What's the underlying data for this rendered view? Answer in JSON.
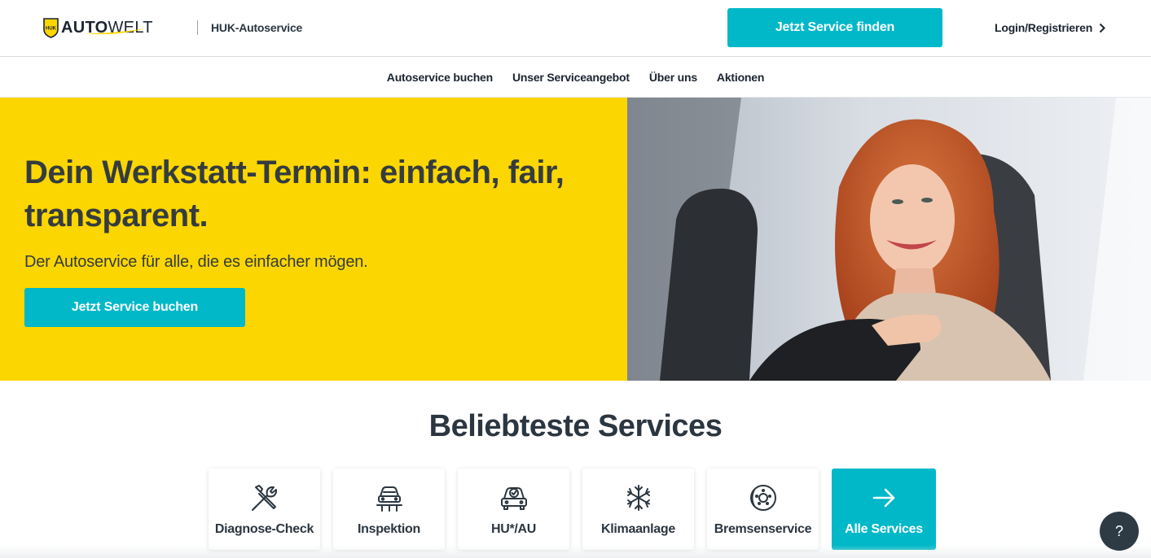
{
  "header": {
    "logo_text_bold": "AUTO",
    "logo_text_light": "WELT",
    "logo_badge_text": "HUK",
    "brand_sub": "HUK-Autoservice",
    "find_button": "Jetzt Service finden",
    "login_label": "Login/Registrieren"
  },
  "nav": {
    "items": [
      {
        "label": "Autoservice buchen"
      },
      {
        "label": "Unser Serviceangebot"
      },
      {
        "label": "Über uns"
      },
      {
        "label": "Aktionen"
      }
    ]
  },
  "hero": {
    "title": "Dein Werkstatt-Termin: einfach, fair, transparent.",
    "subtitle": "Der Autoservice für alle, die es einfacher mögen.",
    "book_button": "Jetzt Service buchen"
  },
  "services": {
    "title": "Beliebteste Services",
    "cards": [
      {
        "label": "Diagnose-Check",
        "icon": "wrench-screwdriver-icon"
      },
      {
        "label": "Inspektion",
        "icon": "car-lift-icon"
      },
      {
        "label": "HU*/AU",
        "icon": "car-check-icon"
      },
      {
        "label": "Klimaanlage",
        "icon": "snowflake-icon"
      },
      {
        "label": "Bremsenservice",
        "icon": "brake-disc-icon"
      },
      {
        "label": "Alle Services",
        "icon": "arrow-right-icon"
      }
    ]
  },
  "help": {
    "label": "?"
  },
  "colors": {
    "accent": "#00b8c8",
    "hero_yellow": "#fcd600",
    "text_dark": "#2b3640"
  }
}
